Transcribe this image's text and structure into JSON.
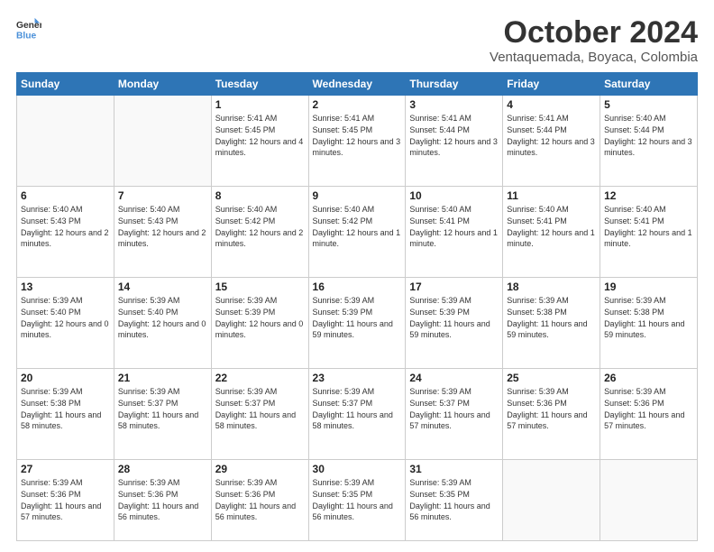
{
  "logo": {
    "line1": "General",
    "line2": "Blue"
  },
  "title": "October 2024",
  "subtitle": "Ventaquemada, Boyaca, Colombia",
  "days_of_week": [
    "Sunday",
    "Monday",
    "Tuesday",
    "Wednesday",
    "Thursday",
    "Friday",
    "Saturday"
  ],
  "weeks": [
    [
      {
        "day": "",
        "info": ""
      },
      {
        "day": "",
        "info": ""
      },
      {
        "day": "1",
        "info": "Sunrise: 5:41 AM\nSunset: 5:45 PM\nDaylight: 12 hours and 4 minutes."
      },
      {
        "day": "2",
        "info": "Sunrise: 5:41 AM\nSunset: 5:45 PM\nDaylight: 12 hours and 3 minutes."
      },
      {
        "day": "3",
        "info": "Sunrise: 5:41 AM\nSunset: 5:44 PM\nDaylight: 12 hours and 3 minutes."
      },
      {
        "day": "4",
        "info": "Sunrise: 5:41 AM\nSunset: 5:44 PM\nDaylight: 12 hours and 3 minutes."
      },
      {
        "day": "5",
        "info": "Sunrise: 5:40 AM\nSunset: 5:44 PM\nDaylight: 12 hours and 3 minutes."
      }
    ],
    [
      {
        "day": "6",
        "info": "Sunrise: 5:40 AM\nSunset: 5:43 PM\nDaylight: 12 hours and 2 minutes."
      },
      {
        "day": "7",
        "info": "Sunrise: 5:40 AM\nSunset: 5:43 PM\nDaylight: 12 hours and 2 minutes."
      },
      {
        "day": "8",
        "info": "Sunrise: 5:40 AM\nSunset: 5:42 PM\nDaylight: 12 hours and 2 minutes."
      },
      {
        "day": "9",
        "info": "Sunrise: 5:40 AM\nSunset: 5:42 PM\nDaylight: 12 hours and 1 minute."
      },
      {
        "day": "10",
        "info": "Sunrise: 5:40 AM\nSunset: 5:41 PM\nDaylight: 12 hours and 1 minute."
      },
      {
        "day": "11",
        "info": "Sunrise: 5:40 AM\nSunset: 5:41 PM\nDaylight: 12 hours and 1 minute."
      },
      {
        "day": "12",
        "info": "Sunrise: 5:40 AM\nSunset: 5:41 PM\nDaylight: 12 hours and 1 minute."
      }
    ],
    [
      {
        "day": "13",
        "info": "Sunrise: 5:39 AM\nSunset: 5:40 PM\nDaylight: 12 hours and 0 minutes."
      },
      {
        "day": "14",
        "info": "Sunrise: 5:39 AM\nSunset: 5:40 PM\nDaylight: 12 hours and 0 minutes."
      },
      {
        "day": "15",
        "info": "Sunrise: 5:39 AM\nSunset: 5:39 PM\nDaylight: 12 hours and 0 minutes."
      },
      {
        "day": "16",
        "info": "Sunrise: 5:39 AM\nSunset: 5:39 PM\nDaylight: 11 hours and 59 minutes."
      },
      {
        "day": "17",
        "info": "Sunrise: 5:39 AM\nSunset: 5:39 PM\nDaylight: 11 hours and 59 minutes."
      },
      {
        "day": "18",
        "info": "Sunrise: 5:39 AM\nSunset: 5:38 PM\nDaylight: 11 hours and 59 minutes."
      },
      {
        "day": "19",
        "info": "Sunrise: 5:39 AM\nSunset: 5:38 PM\nDaylight: 11 hours and 59 minutes."
      }
    ],
    [
      {
        "day": "20",
        "info": "Sunrise: 5:39 AM\nSunset: 5:38 PM\nDaylight: 11 hours and 58 minutes."
      },
      {
        "day": "21",
        "info": "Sunrise: 5:39 AM\nSunset: 5:37 PM\nDaylight: 11 hours and 58 minutes."
      },
      {
        "day": "22",
        "info": "Sunrise: 5:39 AM\nSunset: 5:37 PM\nDaylight: 11 hours and 58 minutes."
      },
      {
        "day": "23",
        "info": "Sunrise: 5:39 AM\nSunset: 5:37 PM\nDaylight: 11 hours and 58 minutes."
      },
      {
        "day": "24",
        "info": "Sunrise: 5:39 AM\nSunset: 5:37 PM\nDaylight: 11 hours and 57 minutes."
      },
      {
        "day": "25",
        "info": "Sunrise: 5:39 AM\nSunset: 5:36 PM\nDaylight: 11 hours and 57 minutes."
      },
      {
        "day": "26",
        "info": "Sunrise: 5:39 AM\nSunset: 5:36 PM\nDaylight: 11 hours and 57 minutes."
      }
    ],
    [
      {
        "day": "27",
        "info": "Sunrise: 5:39 AM\nSunset: 5:36 PM\nDaylight: 11 hours and 57 minutes."
      },
      {
        "day": "28",
        "info": "Sunrise: 5:39 AM\nSunset: 5:36 PM\nDaylight: 11 hours and 56 minutes."
      },
      {
        "day": "29",
        "info": "Sunrise: 5:39 AM\nSunset: 5:36 PM\nDaylight: 11 hours and 56 minutes."
      },
      {
        "day": "30",
        "info": "Sunrise: 5:39 AM\nSunset: 5:35 PM\nDaylight: 11 hours and 56 minutes."
      },
      {
        "day": "31",
        "info": "Sunrise: 5:39 AM\nSunset: 5:35 PM\nDaylight: 11 hours and 56 minutes."
      },
      {
        "day": "",
        "info": ""
      },
      {
        "day": "",
        "info": ""
      }
    ]
  ]
}
